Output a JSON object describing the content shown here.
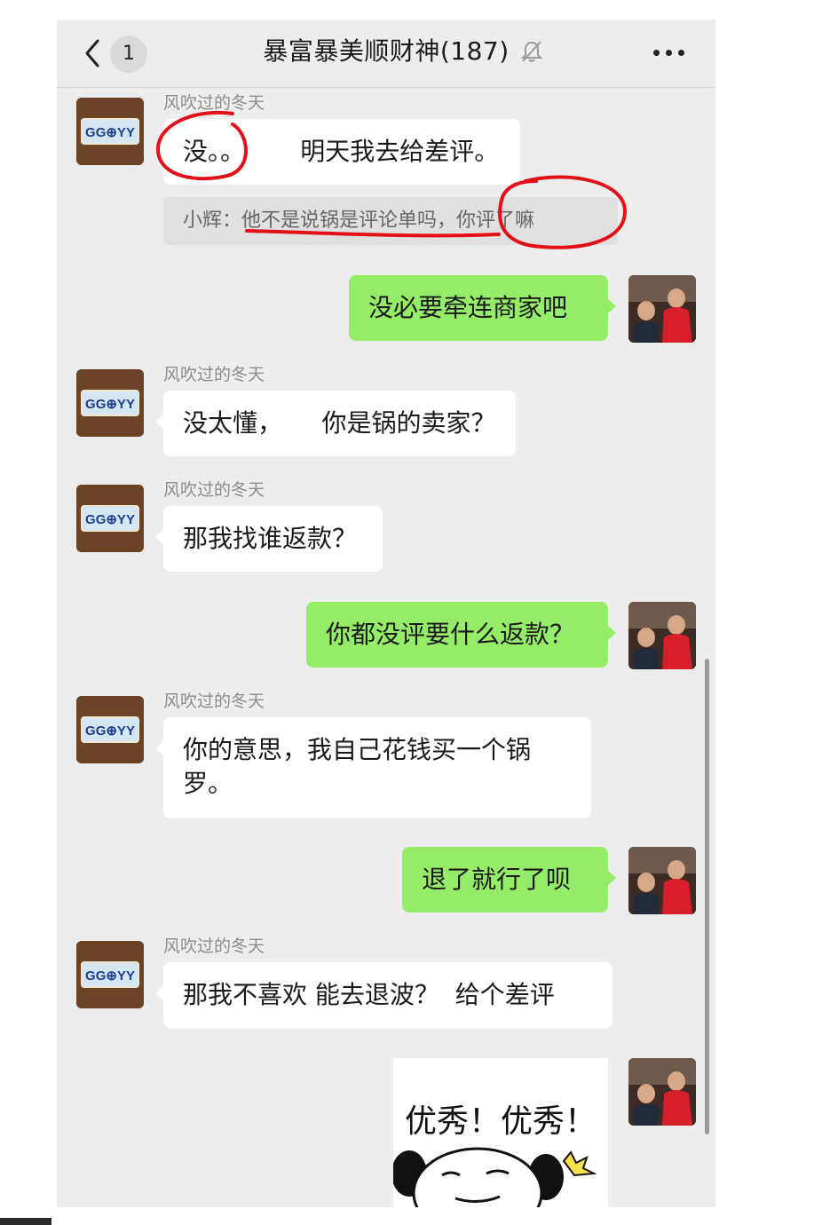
{
  "header": {
    "unread_count": "1",
    "title": "暴富暴美顺财神(187)"
  },
  "messages": [
    {
      "nick": "风吹过的冬天",
      "text": "没。。       明天我去给差评。",
      "quote": "小辉：他不是说锅是评论单吗，你评了嘛"
    },
    {
      "text": "没必要牵连商家吧"
    },
    {
      "nick": "风吹过的冬天",
      "text": "没太懂，     你是锅的卖家？"
    },
    {
      "nick": "风吹过的冬天",
      "text": "那我找谁返款？"
    },
    {
      "text": "你都没评要什么返款？"
    },
    {
      "nick": "风吹过的冬天",
      "line1": "你的意思，我自己花钱买一个锅",
      "line2": "罗。"
    },
    {
      "text": "退了就行了呗"
    },
    {
      "nick": "风吹过的冬天",
      "text": "那我不喜欢 能去退波？  给个差评"
    }
  ],
  "avatar_badge": {
    "text1": "GG",
    "text2": "YY",
    "symbol": "⊕"
  },
  "sticker": {
    "text": "优秀！优秀！"
  },
  "colors": {
    "background": "#ededed",
    "incoming_bubble": "#ffffff",
    "outgoing_bubble": "#95ec69",
    "annotation": "#e3101a"
  },
  "icons": [
    "back-chevron-icon",
    "mute-bell-icon",
    "more-dots-icon"
  ]
}
